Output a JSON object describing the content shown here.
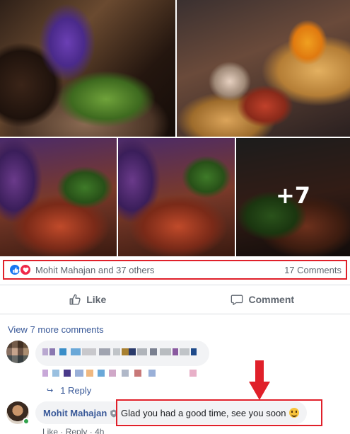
{
  "photos": {
    "more_count": "+7"
  },
  "reactions": {
    "names": "Mohit Mahajan and 37 others",
    "comment_count": "17 Comments",
    "like_color": "#1877f2",
    "love_color": "#f02849"
  },
  "actions": {
    "like_label": "Like",
    "comment_label": "Comment"
  },
  "comments": {
    "view_more": "View 7 more comments",
    "reply_count": "1 Reply",
    "reply": {
      "author": "Mohit Mahajan",
      "text": "Glad you had a good time, see you soon",
      "like": "Like",
      "sep": "·",
      "reply": "Reply",
      "time": "4h"
    }
  },
  "annotation": {
    "highlight_color": "#e0202a"
  }
}
